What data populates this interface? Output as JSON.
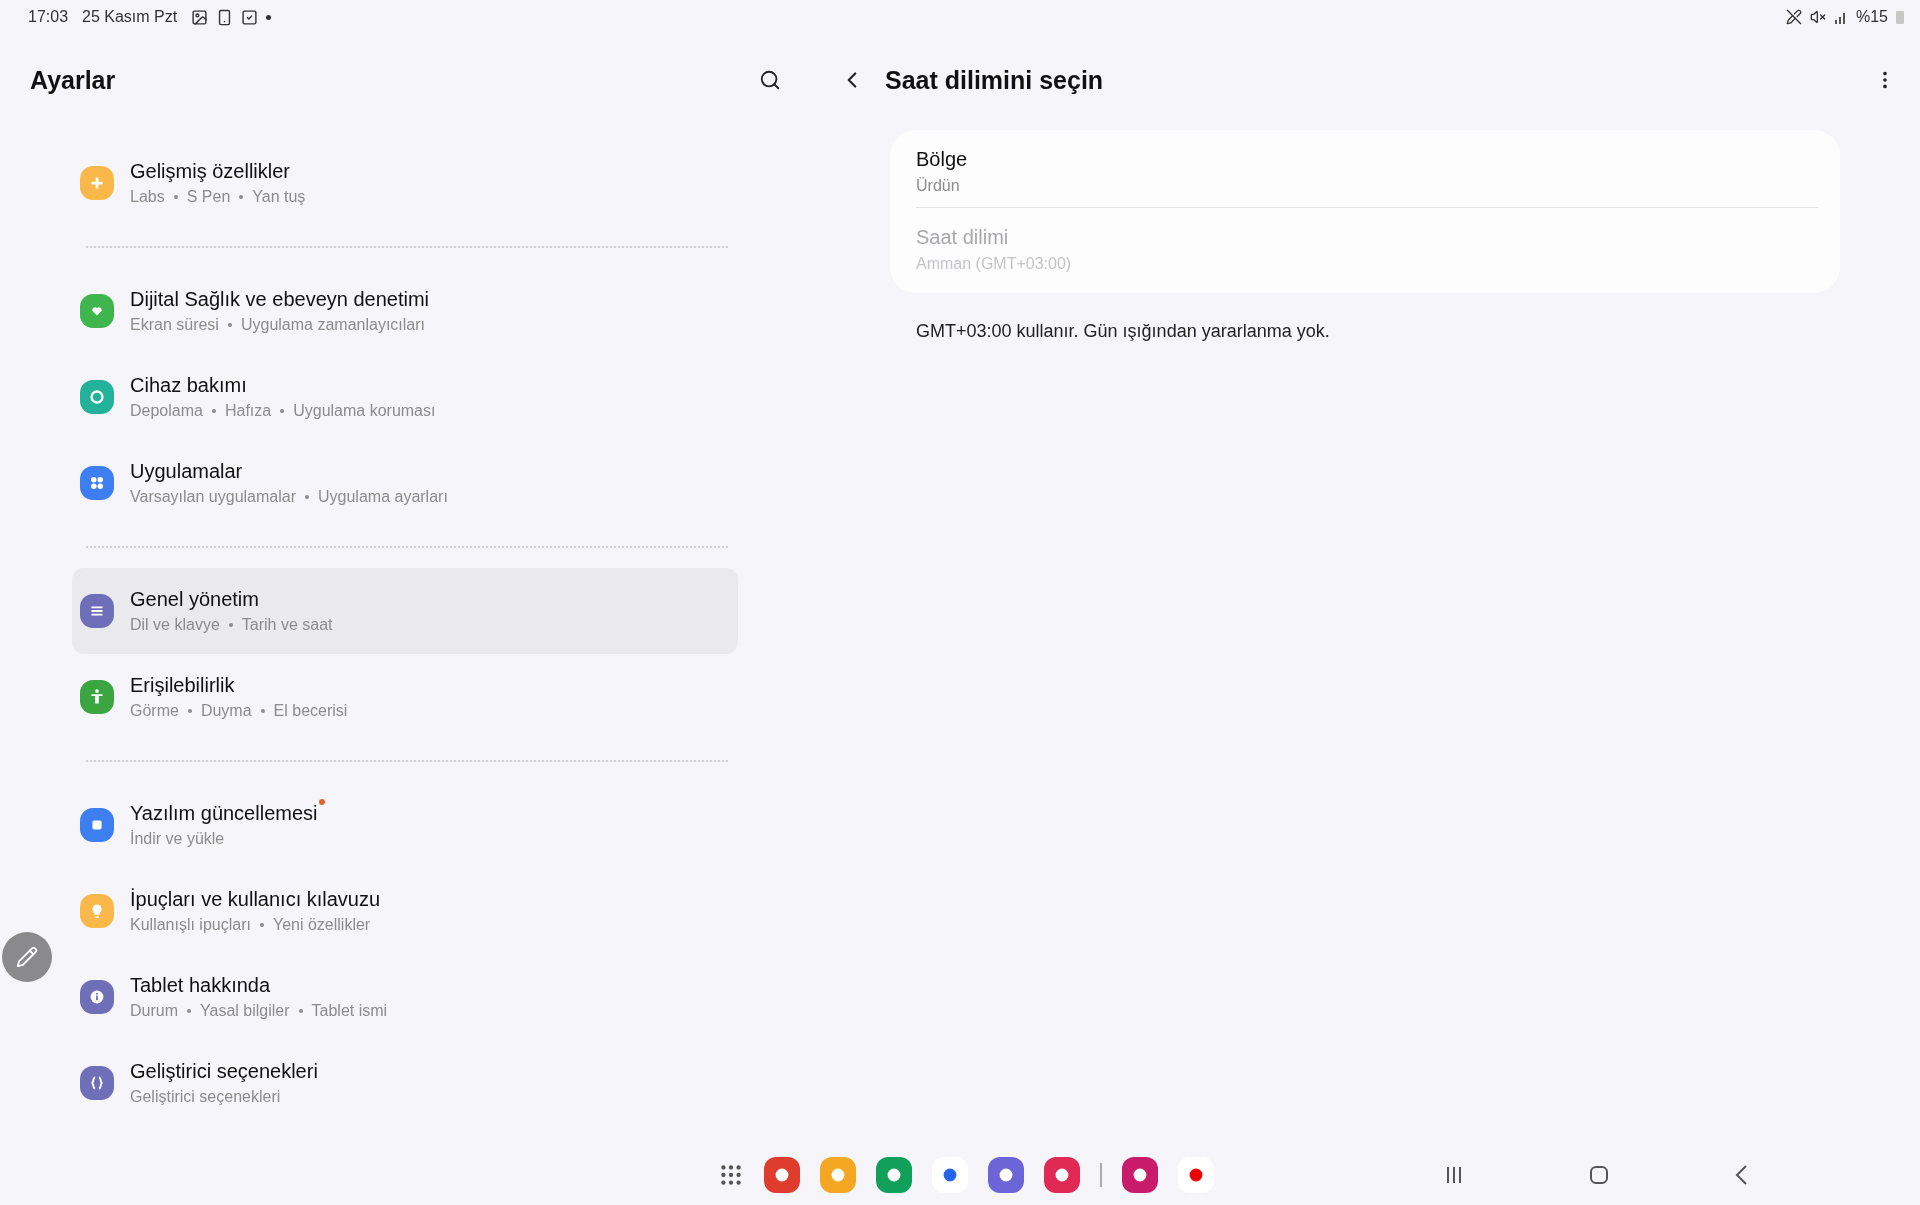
{
  "status_bar": {
    "time": "17:03",
    "date": "25 Kasım Pzt",
    "battery": "%15"
  },
  "sidebar": {
    "title": "Ayarlar",
    "groups": [
      {
        "items": [
          {
            "title": "Gelişmiş özellikler",
            "details": [
              "Labs",
              "S Pen",
              "Yan tuş"
            ],
            "color": "#fbb84a",
            "selected": false,
            "badge": false
          }
        ]
      },
      {
        "items": [
          {
            "title": "Dijital Sağlık ve ebeveyn denetimi",
            "details": [
              "Ekran süresi",
              "Uygulama zamanlayıcıları"
            ],
            "color": "#3fb54e",
            "selected": false,
            "badge": false
          },
          {
            "title": "Cihaz bakımı",
            "details": [
              "Depolama",
              "Hafıza",
              "Uygulama koruması"
            ],
            "color": "#22b29a",
            "selected": false,
            "badge": false
          },
          {
            "title": "Uygulamalar",
            "details": [
              "Varsayılan uygulamalar",
              "Uygulama ayarları"
            ],
            "color": "#3d7ef0",
            "selected": false,
            "badge": false
          }
        ]
      },
      {
        "items": [
          {
            "title": "Genel yönetim",
            "details": [
              "Dil ve klavye",
              "Tarih ve saat"
            ],
            "color": "#6e6fb8",
            "selected": true,
            "badge": false
          },
          {
            "title": "Erişilebilirlik",
            "details": [
              "Görme",
              "Duyma",
              "El becerisi"
            ],
            "color": "#3ba63f",
            "selected": false,
            "badge": false
          }
        ]
      },
      {
        "items": [
          {
            "title": "Yazılım güncellemesi",
            "details": [
              "İndir ve yükle"
            ],
            "color": "#3d7ef0",
            "selected": false,
            "badge": true
          },
          {
            "title": "İpuçları ve kullanıcı kılavuzu",
            "details": [
              "Kullanışlı ipuçları",
              "Yeni özellikler"
            ],
            "color": "#fbb84a",
            "selected": false,
            "badge": false
          },
          {
            "title": "Tablet hakkında",
            "details": [
              "Durum",
              "Yasal bilgiler",
              "Tablet ismi"
            ],
            "color": "#6e6fb8",
            "selected": false,
            "badge": false
          },
          {
            "title": "Geliştirici seçenekleri",
            "details": [
              "Geliştirici seçenekleri"
            ],
            "color": "#6e6fb8",
            "selected": false,
            "badge": false
          }
        ]
      }
    ]
  },
  "detail": {
    "title": "Saat dilimini seçin",
    "rows": [
      {
        "label": "Bölge",
        "value": "Ürdün",
        "disabled": false
      },
      {
        "label": "Saat dilimi",
        "value": "Amman (GMT+03:00)",
        "disabled": true
      }
    ],
    "note": "GMT+03:00 kullanır. Gün ışığından yararlanma yok."
  }
}
